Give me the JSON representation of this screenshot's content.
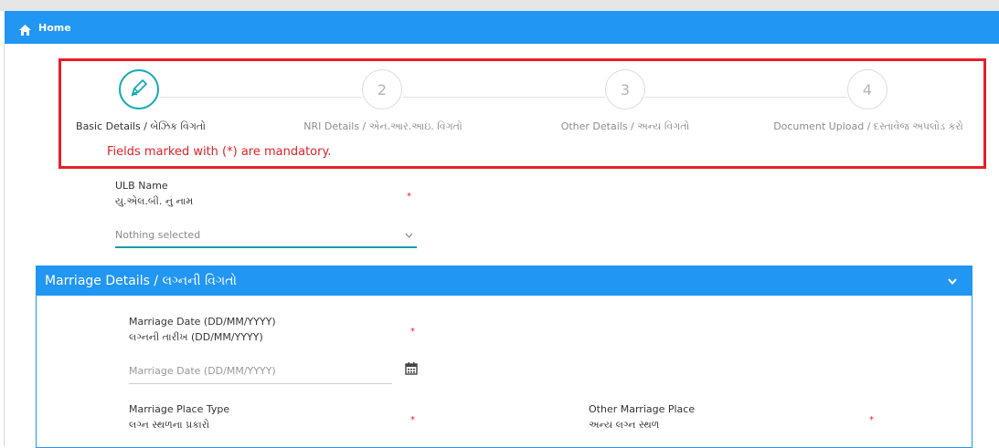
{
  "nav": {
    "home_label": "Home",
    "icon": "home-icon"
  },
  "wizard": {
    "steps": [
      {
        "number": "",
        "label": "Basic Details / બેઝિક વિગતો",
        "active": true,
        "icon": "pencil-icon"
      },
      {
        "number": "2",
        "label": "NRI Details / એન.આર.આઇ. વિગતો",
        "active": false
      },
      {
        "number": "3",
        "label": "Other Details / અન્ય વિગતો",
        "active": false
      },
      {
        "number": "4",
        "label": "Document Upload / દસ્તાવેજ અપલોડ કરો",
        "active": false
      }
    ],
    "mandatory_note": "Fields marked with (*) are mandatory.",
    "highlight_color": "#e32029",
    "accent_color": "#14a8b8"
  },
  "ulb": {
    "label_en": "ULB Name",
    "label_gu": "યુ.એલ.બી. નું નામ",
    "required": "*",
    "selected": "Nothing selected"
  },
  "marriage_panel": {
    "title": "Marriage Details / લગ્નની વિગતો",
    "header_color": "#2196f3",
    "date": {
      "label_en": "Marriage Date (DD/MM/YYYY)",
      "label_gu": "લગ્નની તારીખ (DD/MM/YYYY)",
      "required": "*",
      "placeholder": "Marriage Date (DD/MM/YYYY)",
      "icon": "calendar-icon"
    },
    "place_type": {
      "label_en": "Marriage Place Type",
      "label_gu": "લગ્ન સ્થળના પ્રકારો",
      "required": "*"
    },
    "other_place": {
      "label_en": "Other Marriage Place",
      "label_gu": "અન્ય લગ્ન સ્થળ",
      "required": "*"
    }
  }
}
